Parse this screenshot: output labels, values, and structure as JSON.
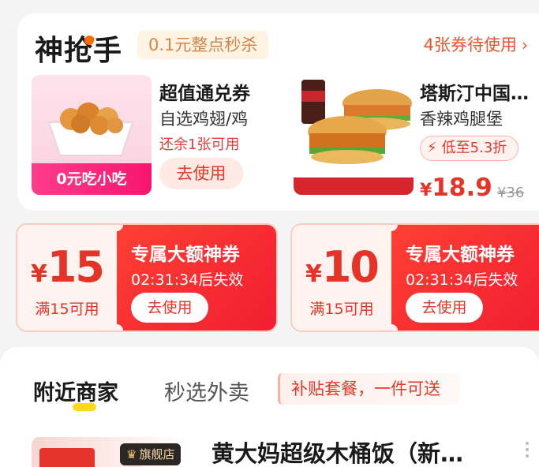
{
  "flash_sale": {
    "brand": "神抢手",
    "subtitle": "0.1元整点秒杀",
    "coupons_pending": "4张券待使用",
    "deal1": {
      "title": "超值通兑券",
      "subtitle": "自选鸡翅/鸡",
      "remaining": "还余1张可用",
      "banner": "0元吃小吃",
      "action": "去使用"
    },
    "deal2": {
      "title": "塔斯汀中国…",
      "subtitle": "香辣鸡腿堡",
      "discount": "低至5.3折",
      "currency": "¥",
      "price": "18.9",
      "original_price": "¥36"
    }
  },
  "big_coupons": [
    {
      "currency": "¥",
      "amount": "15",
      "condition": "满15可用",
      "title": "专属大额神券",
      "timer": "02:31:34后失效",
      "action": "去使用"
    },
    {
      "currency": "¥",
      "amount": "10",
      "condition": "满15可用",
      "title": "专属大额神券",
      "timer": "02:31:34后失效",
      "action": "去使用"
    }
  ],
  "nearby": {
    "tab_active": "附近商家",
    "tab_other": "秒选外卖",
    "promo": "补贴套餐，一件可送",
    "shop": {
      "badge": "旗舰店",
      "name": "黄大妈超级木桶饭（新…"
    }
  },
  "colors": {
    "accent": "#e53427",
    "pink": "#f71570",
    "background": "#f4f4f4"
  }
}
